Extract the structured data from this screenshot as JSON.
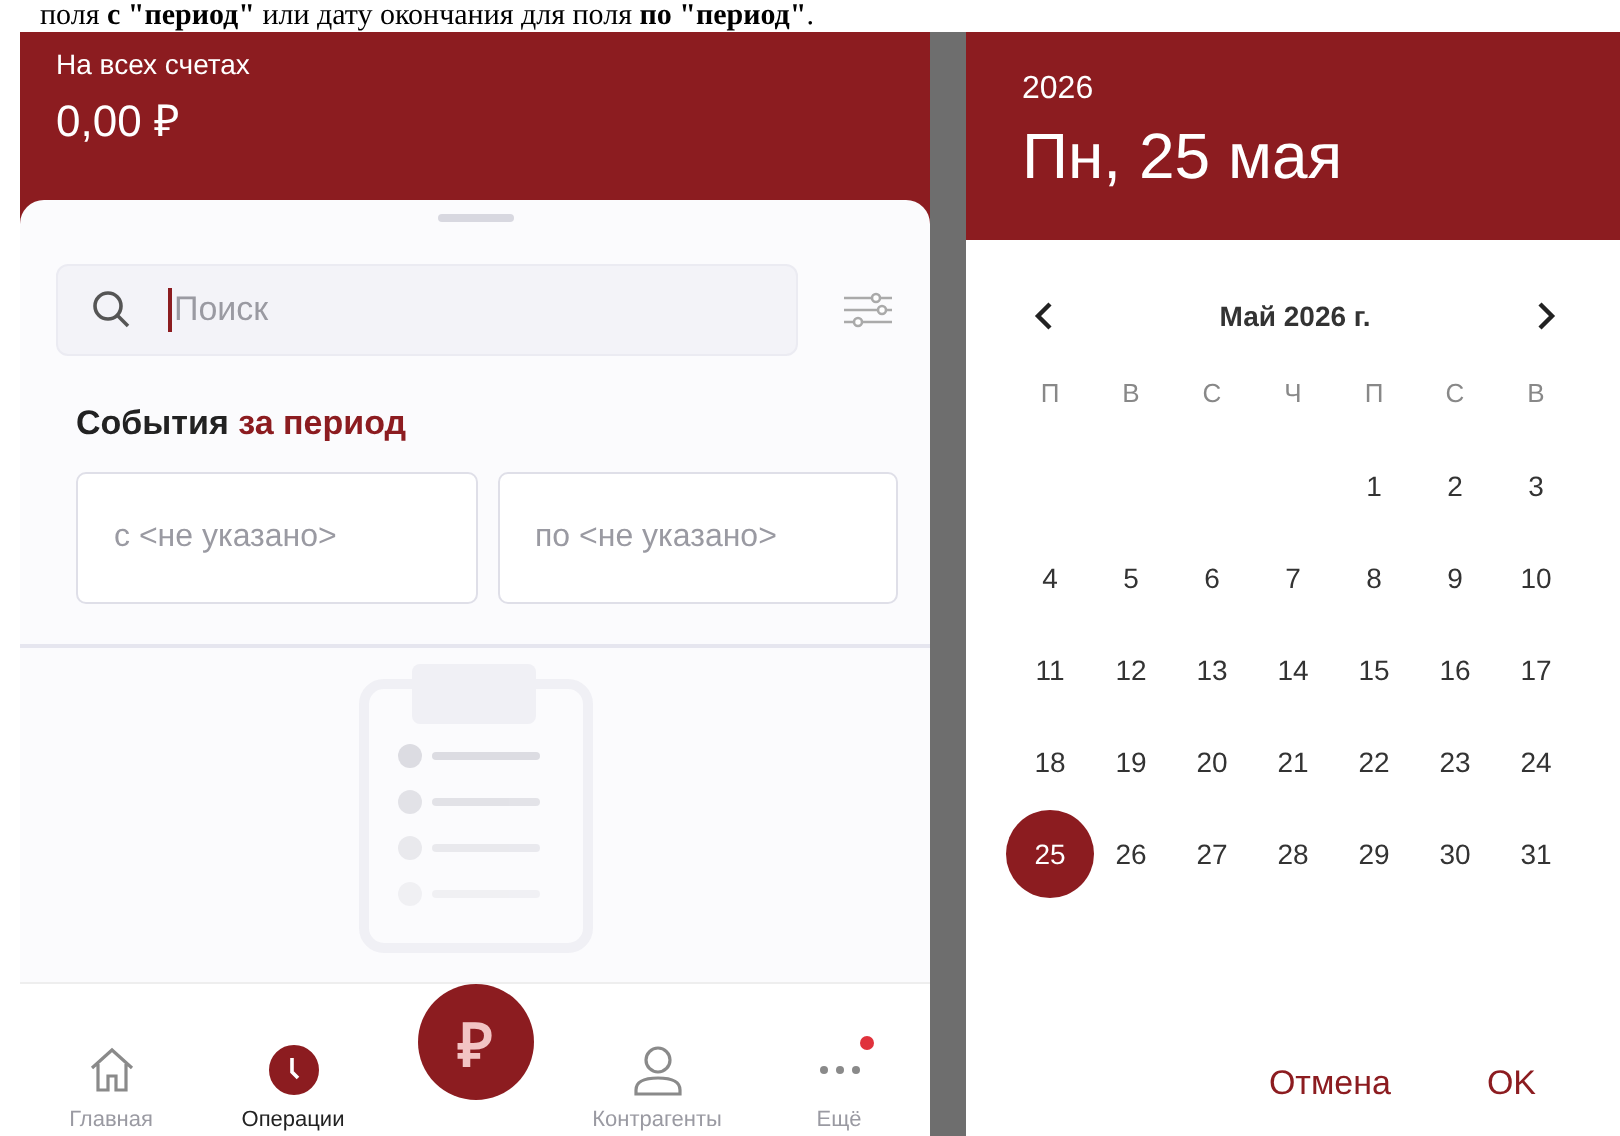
{
  "document_caption": "поля **с \"период\"** или дату окончания для поля **по \"период\"**.",
  "operations_screen": {
    "balance_label": "На всех счетах",
    "balance": "0,00 ₽",
    "search": {
      "placeholder": "Поиск"
    },
    "section_title": "События",
    "section_highlight": "за период",
    "date_fields": [
      {
        "placeholder": "с <не указано>"
      },
      {
        "placeholder": "по <не указано>"
      }
    ],
    "nav": [
      {
        "kind": "home",
        "label": "Главная",
        "selected": false,
        "badge": false
      },
      {
        "kind": "clock",
        "label": "Операции",
        "selected": true,
        "badge": false
      },
      {
        "kind": "action",
        "symbol": "₽"
      },
      {
        "kind": "person",
        "label": "Контрагенты",
        "selected": false,
        "badge": false
      },
      {
        "kind": "more",
        "label": "Ещё",
        "selected": false,
        "badge": true
      }
    ]
  },
  "date_picker": {
    "year": "2026",
    "date": "Пн, 25 мая",
    "month": "Май 2026 г.",
    "weekdays": [
      "П",
      "В",
      "С",
      "Ч",
      "П",
      "С",
      "В"
    ],
    "days": [
      {
        "kind": "blank"
      },
      {
        "kind": "blank"
      },
      {
        "kind": "blank"
      },
      {
        "kind": "blank"
      },
      {
        "kind": "day",
        "label": "1",
        "selected": false
      },
      {
        "kind": "day",
        "label": "2",
        "selected": false
      },
      {
        "kind": "day",
        "label": "3",
        "selected": false
      },
      {
        "kind": "day",
        "label": "4",
        "selected": false
      },
      {
        "kind": "day",
        "label": "5",
        "selected": false
      },
      {
        "kind": "day",
        "label": "6",
        "selected": false
      },
      {
        "kind": "day",
        "label": "7",
        "selected": false
      },
      {
        "kind": "day",
        "label": "8",
        "selected": false
      },
      {
        "kind": "day",
        "label": "9",
        "selected": false
      },
      {
        "kind": "day",
        "label": "10",
        "selected": false
      },
      {
        "kind": "day",
        "label": "11",
        "selected": false
      },
      {
        "kind": "day",
        "label": "12",
        "selected": false
      },
      {
        "kind": "day",
        "label": "13",
        "selected": false
      },
      {
        "kind": "day",
        "label": "14",
        "selected": false
      },
      {
        "kind": "day",
        "label": "15",
        "selected": false
      },
      {
        "kind": "day",
        "label": "16",
        "selected": false
      },
      {
        "kind": "day",
        "label": "17",
        "selected": false
      },
      {
        "kind": "day",
        "label": "18",
        "selected": false
      },
      {
        "kind": "day",
        "label": "19",
        "selected": false
      },
      {
        "kind": "day",
        "label": "20",
        "selected": false
      },
      {
        "kind": "day",
        "label": "21",
        "selected": false
      },
      {
        "kind": "day",
        "label": "22",
        "selected": false
      },
      {
        "kind": "day",
        "label": "23",
        "selected": false
      },
      {
        "kind": "day",
        "label": "24",
        "selected": false
      },
      {
        "kind": "day",
        "label": "25",
        "selected": true
      },
      {
        "kind": "day",
        "label": "26",
        "selected": false
      },
      {
        "kind": "day",
        "label": "27",
        "selected": false
      },
      {
        "kind": "day",
        "label": "28",
        "selected": false
      },
      {
        "kind": "day",
        "label": "29",
        "selected": false
      },
      {
        "kind": "day",
        "label": "30",
        "selected": false
      },
      {
        "kind": "day",
        "label": "31",
        "selected": false
      }
    ],
    "buttons": [
      "Отмена",
      "OK"
    ]
  }
}
